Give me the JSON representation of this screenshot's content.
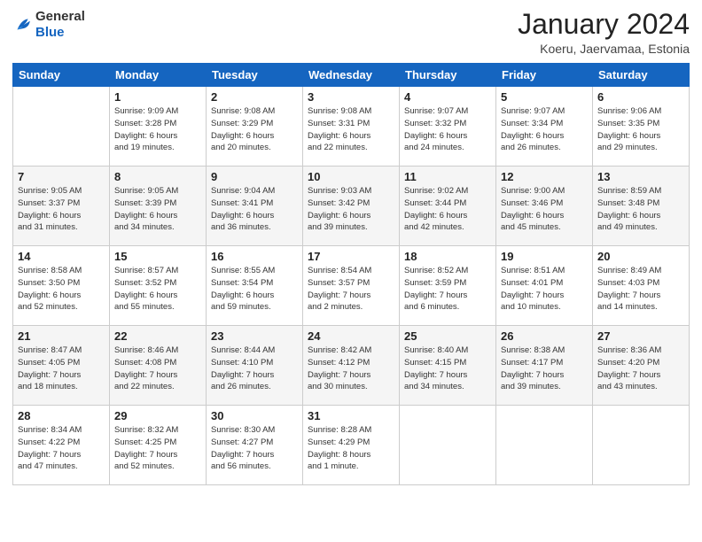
{
  "header": {
    "logo": {
      "general": "General",
      "blue": "Blue"
    },
    "title": "January 2024",
    "location": "Koeru, Jaervamaa, Estonia"
  },
  "columns": [
    "Sunday",
    "Monday",
    "Tuesday",
    "Wednesday",
    "Thursday",
    "Friday",
    "Saturday"
  ],
  "weeks": [
    [
      {
        "day": "",
        "info": ""
      },
      {
        "day": "1",
        "info": "Sunrise: 9:09 AM\nSunset: 3:28 PM\nDaylight: 6 hours\nand 19 minutes."
      },
      {
        "day": "2",
        "info": "Sunrise: 9:08 AM\nSunset: 3:29 PM\nDaylight: 6 hours\nand 20 minutes."
      },
      {
        "day": "3",
        "info": "Sunrise: 9:08 AM\nSunset: 3:31 PM\nDaylight: 6 hours\nand 22 minutes."
      },
      {
        "day": "4",
        "info": "Sunrise: 9:07 AM\nSunset: 3:32 PM\nDaylight: 6 hours\nand 24 minutes."
      },
      {
        "day": "5",
        "info": "Sunrise: 9:07 AM\nSunset: 3:34 PM\nDaylight: 6 hours\nand 26 minutes."
      },
      {
        "day": "6",
        "info": "Sunrise: 9:06 AM\nSunset: 3:35 PM\nDaylight: 6 hours\nand 29 minutes."
      }
    ],
    [
      {
        "day": "7",
        "info": "Sunrise: 9:05 AM\nSunset: 3:37 PM\nDaylight: 6 hours\nand 31 minutes."
      },
      {
        "day": "8",
        "info": "Sunrise: 9:05 AM\nSunset: 3:39 PM\nDaylight: 6 hours\nand 34 minutes."
      },
      {
        "day": "9",
        "info": "Sunrise: 9:04 AM\nSunset: 3:41 PM\nDaylight: 6 hours\nand 36 minutes."
      },
      {
        "day": "10",
        "info": "Sunrise: 9:03 AM\nSunset: 3:42 PM\nDaylight: 6 hours\nand 39 minutes."
      },
      {
        "day": "11",
        "info": "Sunrise: 9:02 AM\nSunset: 3:44 PM\nDaylight: 6 hours\nand 42 minutes."
      },
      {
        "day": "12",
        "info": "Sunrise: 9:00 AM\nSunset: 3:46 PM\nDaylight: 6 hours\nand 45 minutes."
      },
      {
        "day": "13",
        "info": "Sunrise: 8:59 AM\nSunset: 3:48 PM\nDaylight: 6 hours\nand 49 minutes."
      }
    ],
    [
      {
        "day": "14",
        "info": "Sunrise: 8:58 AM\nSunset: 3:50 PM\nDaylight: 6 hours\nand 52 minutes."
      },
      {
        "day": "15",
        "info": "Sunrise: 8:57 AM\nSunset: 3:52 PM\nDaylight: 6 hours\nand 55 minutes."
      },
      {
        "day": "16",
        "info": "Sunrise: 8:55 AM\nSunset: 3:54 PM\nDaylight: 6 hours\nand 59 minutes."
      },
      {
        "day": "17",
        "info": "Sunrise: 8:54 AM\nSunset: 3:57 PM\nDaylight: 7 hours\nand 2 minutes."
      },
      {
        "day": "18",
        "info": "Sunrise: 8:52 AM\nSunset: 3:59 PM\nDaylight: 7 hours\nand 6 minutes."
      },
      {
        "day": "19",
        "info": "Sunrise: 8:51 AM\nSunset: 4:01 PM\nDaylight: 7 hours\nand 10 minutes."
      },
      {
        "day": "20",
        "info": "Sunrise: 8:49 AM\nSunset: 4:03 PM\nDaylight: 7 hours\nand 14 minutes."
      }
    ],
    [
      {
        "day": "21",
        "info": "Sunrise: 8:47 AM\nSunset: 4:05 PM\nDaylight: 7 hours\nand 18 minutes."
      },
      {
        "day": "22",
        "info": "Sunrise: 8:46 AM\nSunset: 4:08 PM\nDaylight: 7 hours\nand 22 minutes."
      },
      {
        "day": "23",
        "info": "Sunrise: 8:44 AM\nSunset: 4:10 PM\nDaylight: 7 hours\nand 26 minutes."
      },
      {
        "day": "24",
        "info": "Sunrise: 8:42 AM\nSunset: 4:12 PM\nDaylight: 7 hours\nand 30 minutes."
      },
      {
        "day": "25",
        "info": "Sunrise: 8:40 AM\nSunset: 4:15 PM\nDaylight: 7 hours\nand 34 minutes."
      },
      {
        "day": "26",
        "info": "Sunrise: 8:38 AM\nSunset: 4:17 PM\nDaylight: 7 hours\nand 39 minutes."
      },
      {
        "day": "27",
        "info": "Sunrise: 8:36 AM\nSunset: 4:20 PM\nDaylight: 7 hours\nand 43 minutes."
      }
    ],
    [
      {
        "day": "28",
        "info": "Sunrise: 8:34 AM\nSunset: 4:22 PM\nDaylight: 7 hours\nand 47 minutes."
      },
      {
        "day": "29",
        "info": "Sunrise: 8:32 AM\nSunset: 4:25 PM\nDaylight: 7 hours\nand 52 minutes."
      },
      {
        "day": "30",
        "info": "Sunrise: 8:30 AM\nSunset: 4:27 PM\nDaylight: 7 hours\nand 56 minutes."
      },
      {
        "day": "31",
        "info": "Sunrise: 8:28 AM\nSunset: 4:29 PM\nDaylight: 8 hours\nand 1 minute."
      },
      {
        "day": "",
        "info": ""
      },
      {
        "day": "",
        "info": ""
      },
      {
        "day": "",
        "info": ""
      }
    ]
  ]
}
